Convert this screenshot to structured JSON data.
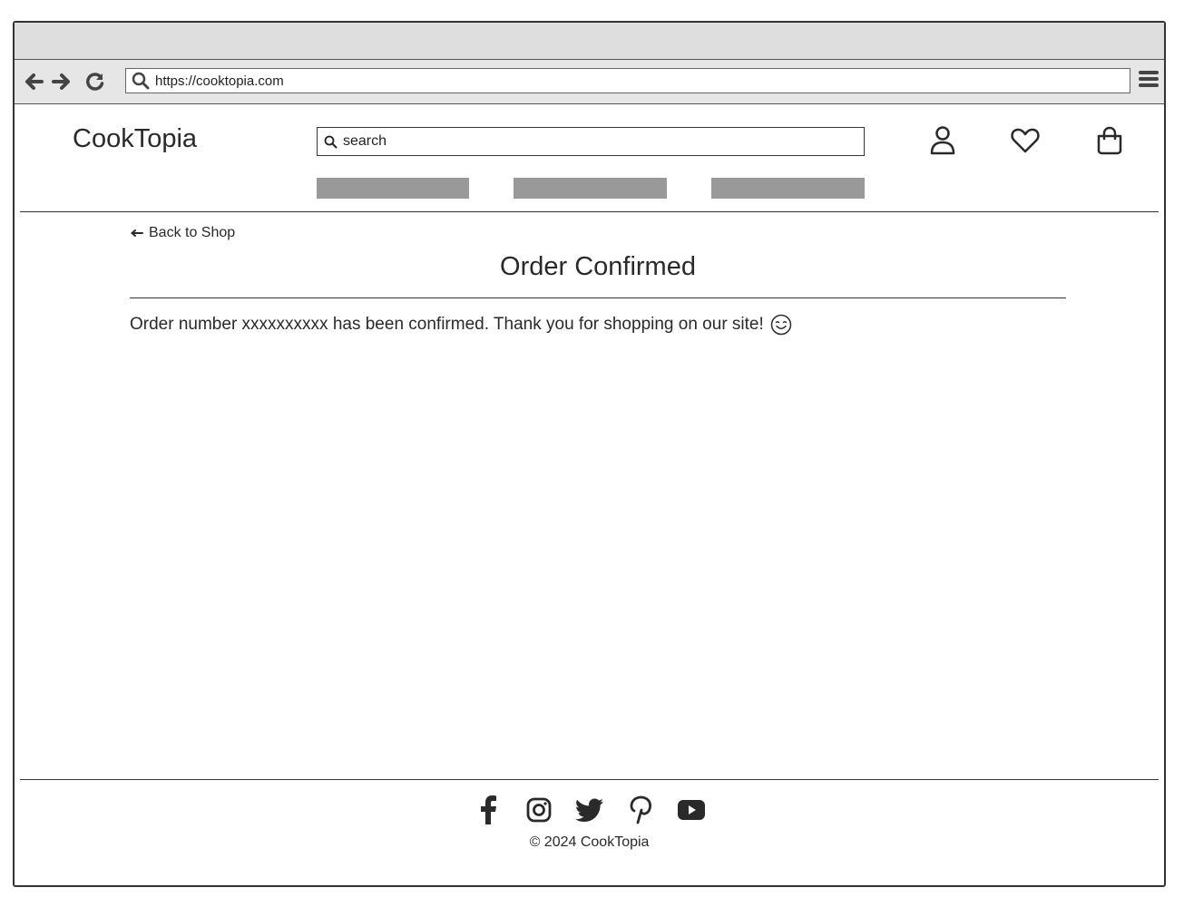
{
  "browser": {
    "url": "https://cooktopia.com",
    "icons": [
      "back-arrow-icon",
      "forward-arrow-icon",
      "reload-icon",
      "search-icon",
      "hamburger-menu-icon"
    ]
  },
  "header": {
    "logo": "CookTopia",
    "search_placeholder": "search",
    "nav_items": [
      "",
      "",
      ""
    ],
    "icons": [
      "user-icon",
      "heart-icon",
      "shopping-bag-icon"
    ]
  },
  "main": {
    "back_link": "Back to Shop",
    "title": "Order Confirmed",
    "message": "Order number xxxxxxxxxx has been confirmed. Thank you for shopping on our site!",
    "message_icon": "smiley-face-icon"
  },
  "footer": {
    "social_icons": [
      "facebook-icon",
      "instagram-icon",
      "twitter-icon",
      "pinterest-icon",
      "youtube-icon"
    ],
    "copyright": "© 2024 CookTopia"
  },
  "colors": {
    "text": "#2a2a2a",
    "chrome": "#dedede",
    "placeholder_block": "#999999"
  }
}
